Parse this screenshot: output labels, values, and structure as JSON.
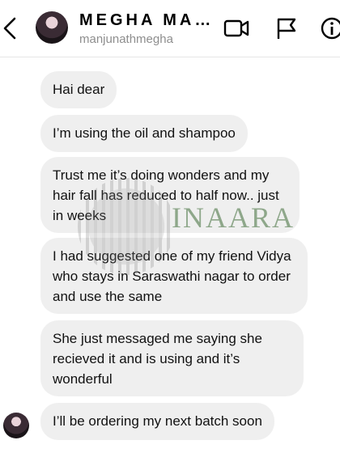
{
  "header": {
    "title": "MEGHA MA…",
    "username": "manjunathmegha",
    "icons": [
      "back-icon",
      "video-call-icon",
      "flag-icon",
      "info-icon"
    ]
  },
  "messages": [
    {
      "text": "Hai dear"
    },
    {
      "text": "I’m using the oil and shampoo"
    },
    {
      "text": "Trust me it’s doing wonders and my hair fall has reduced to half now.. just in weeks"
    },
    {
      "text": "I had suggested one of my friend Vidya who stays in Saraswathi nagar to order and use the same"
    },
    {
      "text": "She just messaged me saying she recieved it and is using and it’s wonderful"
    },
    {
      "text": "I’ll be ordering my next batch soon"
    }
  ],
  "watermark": {
    "text": "INAARA"
  },
  "colors": {
    "bubble": "#efefef",
    "subtitle": "#8e8e8e",
    "watermark": "#3f6d39"
  }
}
